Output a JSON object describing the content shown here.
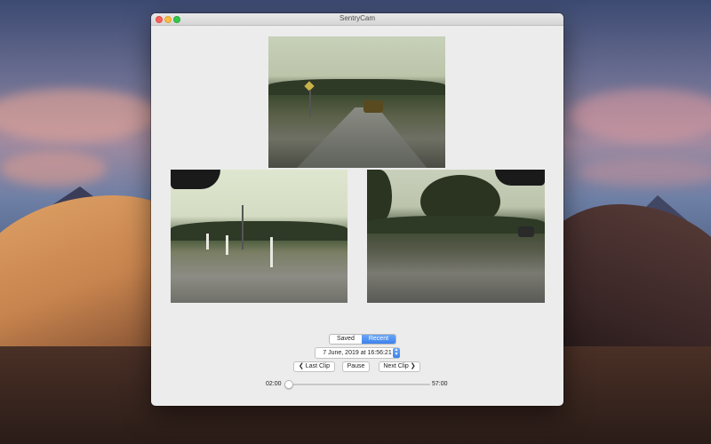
{
  "window": {
    "title": "SentryCam"
  },
  "cameras": {
    "front": "front-camera",
    "left": "left-repeater-camera",
    "right": "right-repeater-camera"
  },
  "clip_mode": {
    "options": [
      "Saved",
      "Recent"
    ],
    "selected": "Recent"
  },
  "clip_date": {
    "value": "7 June, 2019 at 16:56:21"
  },
  "playback": {
    "last_clip_label": "Last Clip",
    "pause_label": "Pause",
    "next_clip_label": "Next Clip",
    "position_fraction": 0.03
  },
  "timeline": {
    "start_time": "02:00",
    "end_time": "57:00"
  },
  "colors": {
    "accent": "#3d82ee"
  }
}
